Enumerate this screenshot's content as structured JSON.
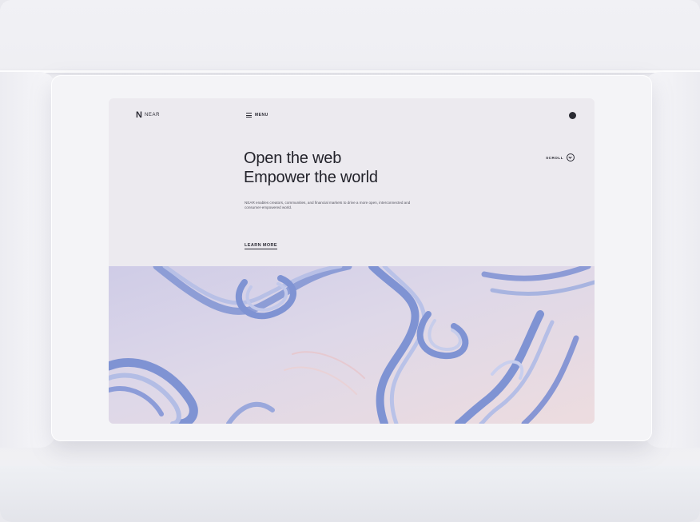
{
  "nav": {
    "logo_mark": "N",
    "logo_text": "NEAR",
    "menu_label": "MENU"
  },
  "hero": {
    "title_line1": "Open the web",
    "title_line2": "Empower the world",
    "description": "NEAR enables creators, communities, and financial markets to drive a more open, interconnected and consumer-empowered world.",
    "cta_label": "LEARN MORE",
    "scroll_label": "SCROLL"
  },
  "artwork": {
    "name": "topographic-waves-artwork",
    "colors": [
      "#c9c8e6",
      "#a9b4e0",
      "#7f93d3",
      "#e7d6dc",
      "#efe0e2"
    ]
  }
}
